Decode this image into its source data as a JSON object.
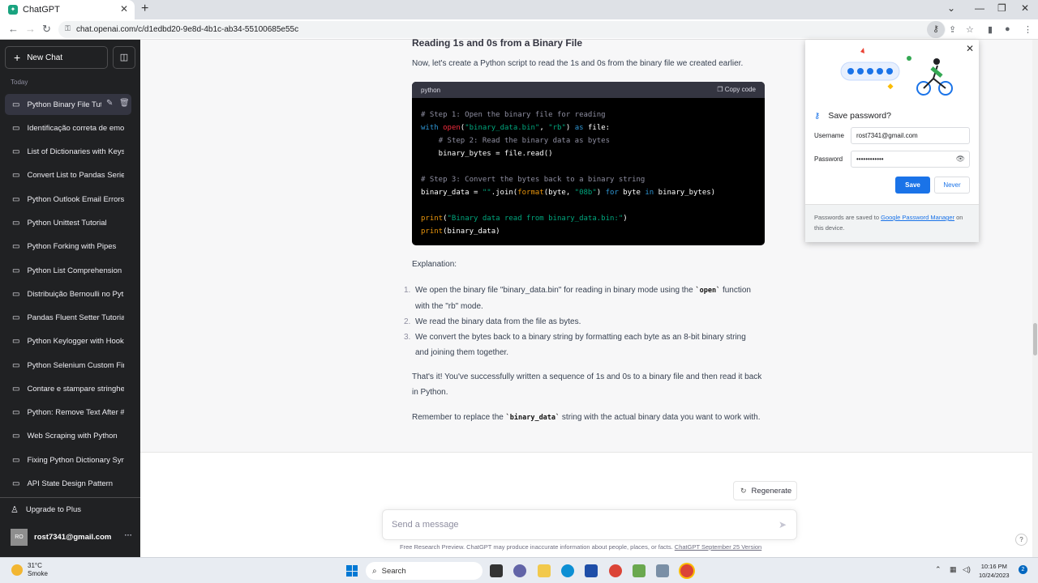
{
  "browser": {
    "tab_title": "ChatGPT",
    "url": "chat.openai.com/c/d1edbd20-9e8d-4b1c-ab34-55100685e55c"
  },
  "sidebar": {
    "new_chat": "New Chat",
    "section": "Today",
    "items": [
      {
        "label": "Python Binary File Tut"
      },
      {
        "label": "Identificação correta de emo"
      },
      {
        "label": "List of Dictionaries with Keys"
      },
      {
        "label": "Convert List to Pandas Series"
      },
      {
        "label": "Python Outlook Email Errors"
      },
      {
        "label": "Python Unittest Tutorial"
      },
      {
        "label": "Python Forking with Pipes"
      },
      {
        "label": "Python List Comprehension"
      },
      {
        "label": "Distribuição Bernoulli no Pyt"
      },
      {
        "label": "Pandas Fluent Setter Tutorial"
      },
      {
        "label": "Python Keylogger with Hook"
      },
      {
        "label": "Python Selenium Custom Fir"
      },
      {
        "label": "Contare e stampare stringhe"
      },
      {
        "label": "Python: Remove Text After #"
      },
      {
        "label": "Web Scraping with Python"
      },
      {
        "label": "Fixing Python Dictionary Syn"
      },
      {
        "label": "API State Design Pattern"
      }
    ],
    "upgrade": "Upgrade to Plus",
    "user_initials": "RO",
    "user_email": "rost7341@gmail.com"
  },
  "message": {
    "heading": "Reading 1s and 0s from a Binary File",
    "intro": "Now, let's create a Python script to read the 1s and 0s from the binary file we created earlier.",
    "code_lang": "python",
    "copy_label": "Copy code",
    "explanation_label": "Explanation:",
    "steps": [
      {
        "num": "1.",
        "text_a": "We open the binary file \"binary_data.bin\" for reading in binary mode using the ",
        "code": "`open`",
        "text_b": " function with the \"rb\" mode."
      },
      {
        "num": "2.",
        "text_a": "We read the binary data from the file as bytes.",
        "code": "",
        "text_b": ""
      },
      {
        "num": "3.",
        "text_a": "We convert the bytes back to a binary string by formatting each byte as an 8-bit binary string and joining them together.",
        "code": "",
        "text_b": ""
      }
    ],
    "closing": "That's it! You've successfully written a sequence of 1s and 0s to a binary file and then read it back in Python.",
    "reminder_a": "Remember to replace the ",
    "reminder_code": "`binary_data`",
    "reminder_b": " string with the actual binary data you want to work with."
  },
  "composer": {
    "regenerate": "Regenerate",
    "placeholder": "Send a message",
    "disclaimer": "Free Research Preview. ChatGPT may produce inaccurate information about people, places, or facts.",
    "version_link": "ChatGPT September 25 Version",
    "help": "?"
  },
  "password_popup": {
    "title": "Save password?",
    "username_label": "Username",
    "username_value": "rost7341@gmail.com",
    "password_label": "Password",
    "password_value": "••••••••••••",
    "save": "Save",
    "never": "Never",
    "footer_a": "Passwords are saved to ",
    "footer_link": "Google Password Manager",
    "footer_b": " on this device."
  },
  "taskbar": {
    "temp": "31°C",
    "weather": "Smoke",
    "search": "Search",
    "time": "10:16 PM",
    "date": "10/24/2023",
    "notifications": "2"
  },
  "colors": {
    "sidebar_bg": "#202123",
    "accent_blue": "#1a73e8",
    "code_bg": "#000000"
  }
}
